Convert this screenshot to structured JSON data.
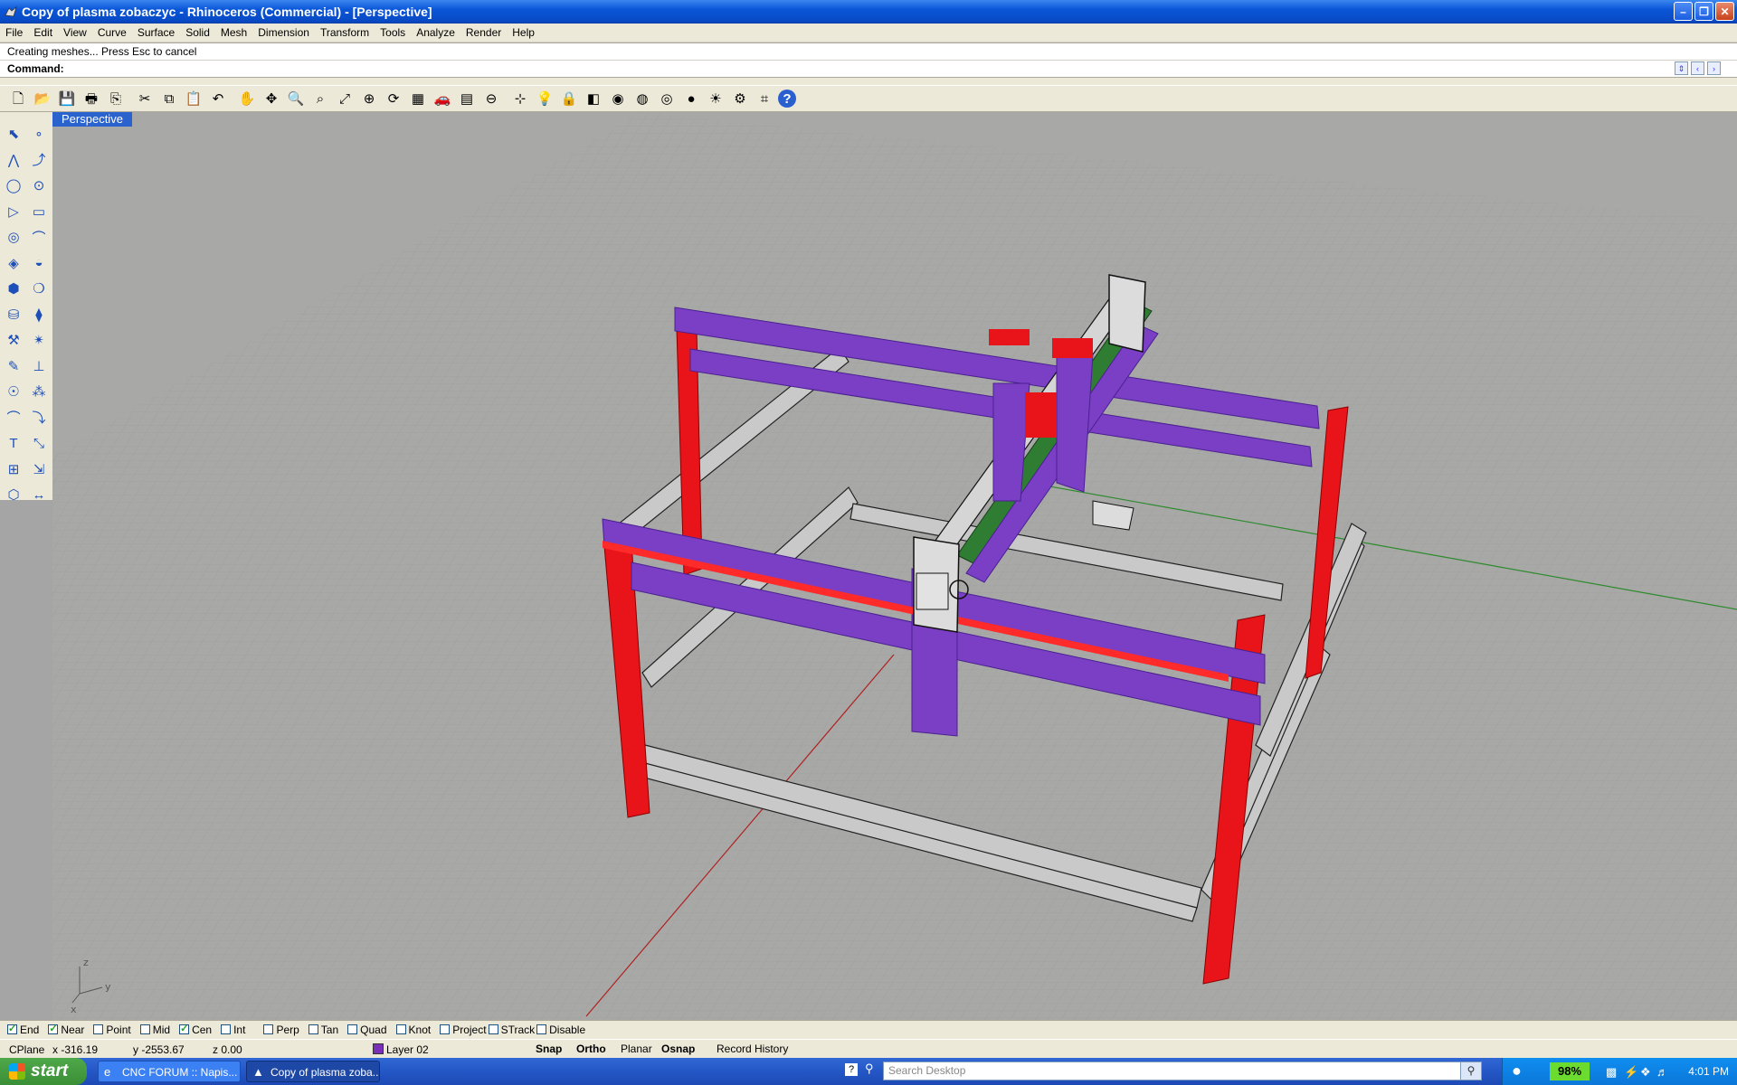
{
  "window": {
    "title": "Copy of plasma zobaczyc - Rhinoceros (Commercial) - [Perspective]"
  },
  "menu": [
    "File",
    "Edit",
    "View",
    "Curve",
    "Surface",
    "Solid",
    "Mesh",
    "Dimension",
    "Transform",
    "Tools",
    "Analyze",
    "Render",
    "Help"
  ],
  "history_text": "Creating meshes... Press Esc to cancel",
  "command_label": "Command:",
  "toolbar_icons": [
    "new-file",
    "open",
    "save",
    "print",
    "import",
    "cut",
    "copy",
    "paste",
    "undo",
    "pan",
    "rotate",
    "zoom",
    "zoom-window",
    "zoom-extents",
    "zoom-selected",
    "zoom-dynamic",
    "viewport-layout",
    "car",
    "grid",
    "cplane",
    "osnap",
    "light",
    "lock",
    "layer",
    "color-wheel",
    "wireframe",
    "ghosted",
    "render-sphere",
    "sun",
    "options",
    "named-views",
    "help"
  ],
  "left_tools": [
    "select",
    "point",
    "polyline",
    "curve-edit",
    "circle",
    "circle-3pt",
    "polygon",
    "rectangle",
    "ellipse",
    "fillet",
    "surface",
    "surface-edit",
    "solid-box",
    "boolean",
    "cylinder",
    "extrude",
    "transform",
    "explode",
    "gear",
    "mirror",
    "group",
    "analyze",
    "arc",
    "arc-curve",
    "text",
    "scale",
    "array",
    "transform2",
    "block",
    "dimension"
  ],
  "viewport": {
    "label": "Perspective"
  },
  "snaps": [
    {
      "label": "End",
      "checked": true
    },
    {
      "label": "Near",
      "checked": true
    },
    {
      "label": "Point",
      "checked": false
    },
    {
      "label": "Mid",
      "checked": false
    },
    {
      "label": "Cen",
      "checked": true
    },
    {
      "label": "Int",
      "checked": false
    },
    {
      "label": "Perp",
      "checked": false
    },
    {
      "label": "Tan",
      "checked": false
    },
    {
      "label": "Quad",
      "checked": false
    },
    {
      "label": "Knot",
      "checked": false
    },
    {
      "label": "Project",
      "checked": false
    },
    {
      "label": "STrack",
      "checked": false
    },
    {
      "label": "Disable",
      "checked": false
    }
  ],
  "status": {
    "cplane": "CPlane",
    "x": "x -316.19",
    "y": "y -2553.67",
    "z": "z 0.00",
    "layer": "Layer 02",
    "layer_color": "#7a2fb8",
    "snap": "Snap",
    "ortho": "Ortho",
    "planar": "Planar",
    "osnap": "Osnap",
    "record_history": "Record History"
  },
  "taskbar": {
    "start": "start",
    "tasks": [
      "CNC FORUM :: Napis...",
      "Copy of plasma zoba..."
    ],
    "search_placeholder": "Search Desktop",
    "battery": "98%",
    "clock": "4:01 PM"
  },
  "colors": {
    "purple": "#7a3fc4",
    "red": "#e8141a",
    "green": "#2f7d32",
    "grey": "#b9b9b9"
  }
}
